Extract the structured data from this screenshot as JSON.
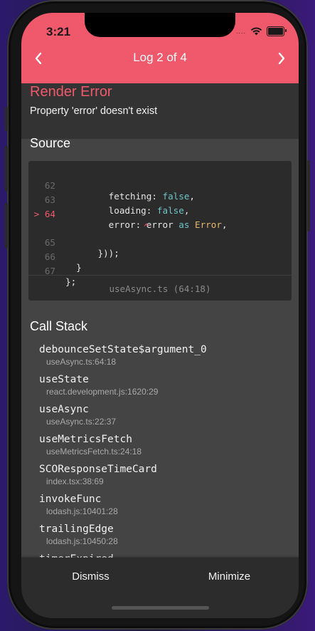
{
  "status_bar": {
    "time": "3:21",
    "signal_dots": "....",
    "wifi_icon": "wifi-icon",
    "battery_icon": "battery-icon"
  },
  "nav": {
    "title": "Log 2 of 4",
    "prev_icon": "chevron-left-icon",
    "next_icon": "chevron-right-icon"
  },
  "error": {
    "title": "Render Error",
    "message": "Property 'error' doesn't exist"
  },
  "source": {
    "heading": "Source",
    "file": "useAsync.ts (64:18)",
    "error_marker": ">",
    "caret": "^",
    "lines": [
      {
        "num": "62",
        "indent": "        ",
        "text": "fetching: ",
        "kw": "false",
        "rest": ","
      },
      {
        "num": "63",
        "indent": "        ",
        "text": "loading: ",
        "kw": "false",
        "rest": ","
      },
      {
        "num": "64",
        "indent": "        ",
        "text": "error: error ",
        "kw": "as",
        "rest": " ",
        "type": "Error",
        "tail": ","
      },
      {
        "num": "65",
        "indent": "      ",
        "text": "}));"
      },
      {
        "num": "66",
        "indent": "  ",
        "text": "}"
      },
      {
        "num": "67",
        "indent": "",
        "text": "};"
      }
    ]
  },
  "call_stack": {
    "heading": "Call Stack",
    "frames": [
      {
        "name": "debounceSetState$argument_0",
        "location": "useAsync.ts:64:18"
      },
      {
        "name": "useState",
        "location": "react.development.js:1620:29"
      },
      {
        "name": "useAsync",
        "location": "useAsync.ts:22:37"
      },
      {
        "name": "useMetricsFetch",
        "location": "useMetricsFetch.ts:24:18"
      },
      {
        "name": "SCOResponseTimeCard",
        "location": "index.tsx:38:69"
      },
      {
        "name": "invokeFunc",
        "location": "lodash.js:10401:28"
      },
      {
        "name": "trailingEdge",
        "location": "lodash.js:10450:28"
      },
      {
        "name": "timerExpired",
        "location": ""
      }
    ]
  },
  "footer": {
    "dismiss": "Dismiss",
    "minimize": "Minimize"
  },
  "colors": {
    "accent": "#f0596b",
    "background": "#444444",
    "code_bg": "#2b2b2b"
  }
}
